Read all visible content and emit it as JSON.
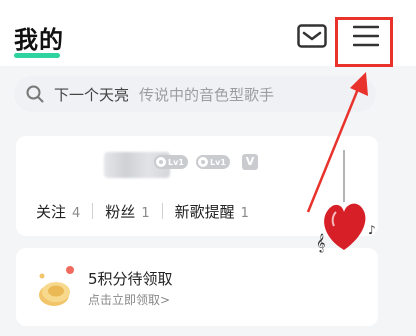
{
  "header": {
    "title": "我的",
    "mail_icon": "mail-icon",
    "menu_icon": "menu-icon",
    "highlight_color": "#e8322b",
    "accent": "#2fd39f"
  },
  "search": {
    "icon": "search-icon",
    "main_text": "下一个天亮",
    "hint_text": "传说中的音色型歌手"
  },
  "profile": {
    "badges": [
      "Lv1",
      "Lv1",
      "V"
    ],
    "stats": [
      {
        "label": "关注",
        "count": "4"
      },
      {
        "label": "粉丝",
        "count": "1"
      },
      {
        "label": "新歌提醒",
        "count": "1"
      }
    ]
  },
  "points": {
    "icon": "coin-icon",
    "title": "5积分待领取",
    "subtitle": "点击立即领取>"
  }
}
